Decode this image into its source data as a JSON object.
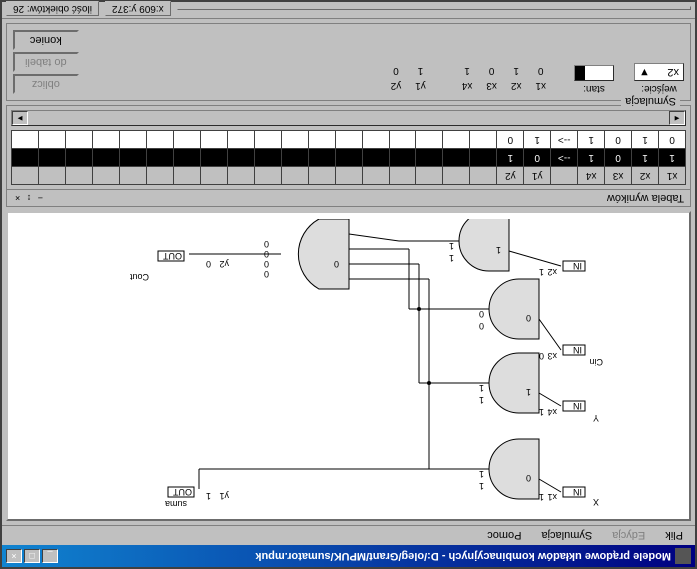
{
  "titlebar": {
    "title": "Modele prądowe układów kombinacyjnych - D:/oleg/Grant/MPUK/sumator.mpuk",
    "min": "_",
    "max": "□",
    "close": "×"
  },
  "menu": {
    "plik": "Plik",
    "edycja": "Edycja",
    "symulacja": "Symulacja",
    "pomoc": "Pomoc"
  },
  "circuit": {
    "labels": {
      "X": "X",
      "Y": "Y",
      "Cin": "Cin",
      "suma": "suma",
      "Cout": "Cout"
    },
    "pins": {
      "IN": "IN",
      "OUT": "OUT"
    },
    "signals": {
      "x1": "x1",
      "x2": "x2",
      "x3": "x3",
      "x4": "x4",
      "y1": "y1",
      "y2": "y2"
    },
    "wirevals": {
      "zero": "0",
      "one": "1"
    }
  },
  "table_panel": {
    "title": "Tabela wyników",
    "ctrl": "− ↕ ×"
  },
  "chart_data": {
    "type": "table",
    "headers": [
      "x1",
      "x2",
      "x3",
      "x4",
      "",
      "y1",
      "y2"
    ],
    "rows": [
      [
        "1",
        "1",
        "0",
        "1",
        "-->",
        "0",
        "1"
      ],
      [
        "0",
        "1",
        "0",
        "1",
        "-->",
        "1",
        "0"
      ]
    ]
  },
  "sim_panel": {
    "legend": "Symulacja",
    "wejscie_label": "wejście:",
    "wejscie_value": "x2",
    "stan_label": "stan:",
    "dropdown_arrow": "▼",
    "io_rows": [
      {
        "n": "x1",
        "v": "0"
      },
      {
        "n": "x2",
        "v": "1"
      },
      {
        "n": "x3",
        "v": "0"
      },
      {
        "n": "x4",
        "v": "1"
      }
    ],
    "out_rows": [
      {
        "n": "y1",
        "v": "1"
      },
      {
        "n": "y2",
        "v": "0"
      }
    ],
    "buttons": {
      "oblicz": "oblicz",
      "do_tabeli": "do tabeli",
      "koniec": "koniec"
    }
  },
  "statusbar": {
    "coords": "x:609 y:372",
    "objcount": "ilość obiektów: 26"
  }
}
